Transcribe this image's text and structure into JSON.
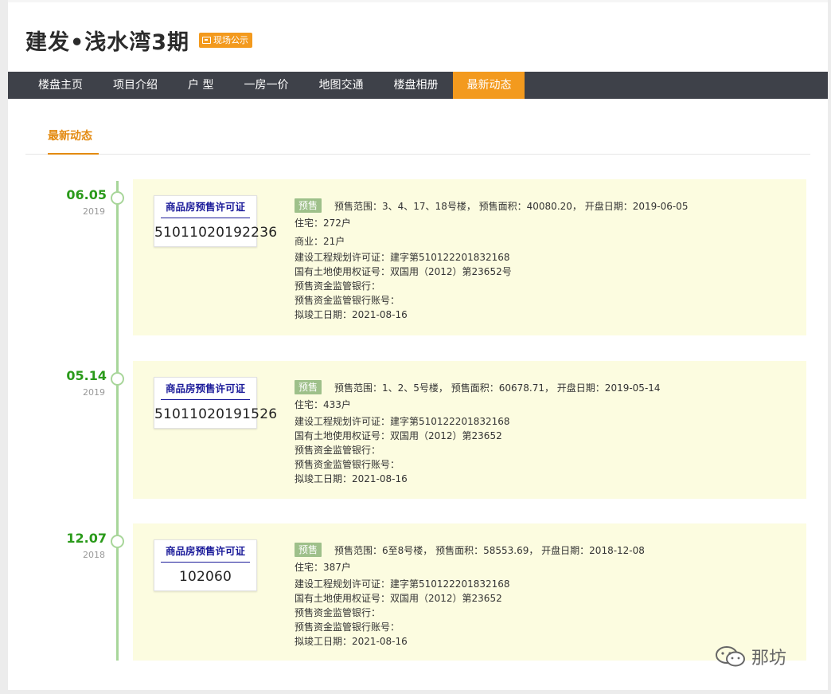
{
  "header": {
    "title": "建发•浅水湾3期",
    "badge": "现场公示"
  },
  "nav": {
    "items": [
      "楼盘主页",
      "项目介绍",
      "户 型",
      "一房一价",
      "地图交通",
      "楼盘相册",
      "最新动态"
    ],
    "active_index": 6
  },
  "section": {
    "tab": "最新动态"
  },
  "entries": [
    {
      "date_md": "06.05",
      "year": "2019",
      "permit_title": "商品房预售许可证",
      "permit_no": "51011020192236",
      "tag": "预售",
      "summary": "预售范围：3、4、17、18号楼， 预售面积：40080.20， 开盘日期：2019-06-05",
      "lines": [
        "住宅：272户",
        "商业：21户",
        "建设工程规划许可证：建字第510122201832168",
        "国有土地使用权证号：双国用（2012）第23652号",
        "预售资金监管银行：",
        "预售资金监管银行账号：",
        "拟竣工日期：2021-08-16"
      ]
    },
    {
      "date_md": "05.14",
      "year": "2019",
      "permit_title": "商品房预售许可证",
      "permit_no": "51011020191526",
      "tag": "预售",
      "summary": "预售范围：1、2、5号楼， 预售面积：60678.71， 开盘日期：2019-05-14",
      "lines": [
        "住宅：433户",
        "建设工程规划许可证：建字第510122201832168",
        "国有土地使用权证号：双国用（2012）第23652",
        "预售资金监管银行：",
        "预售资金监管银行账号：",
        "拟竣工日期：2021-08-16"
      ]
    },
    {
      "date_md": "12.07",
      "year": "2018",
      "permit_title": "商品房预售许可证",
      "permit_no": "102060",
      "tag": "预售",
      "summary": "预售范围：6至8号楼， 预售面积：58553.69， 开盘日期：2018-12-08",
      "lines": [
        "住宅：387户",
        "建设工程规划许可证：建字第510122201832168",
        "国有土地使用权证号：双国用（2012）第23652",
        "预售资金监管银行：",
        "预售资金监管银行账号：",
        "拟竣工日期：2021-08-16"
      ]
    }
  ],
  "watermark": {
    "text": "那坊",
    "icon": "wechat-icon"
  },
  "colors": {
    "accent": "#f39a1e",
    "nav_bg": "#3e4149",
    "timeline": "#a8d69a",
    "date_green": "#2a9a1a",
    "card_bg": "#fcfce0",
    "tag_bg": "#9ec08a",
    "permit_blue": "#1c1c9a"
  }
}
